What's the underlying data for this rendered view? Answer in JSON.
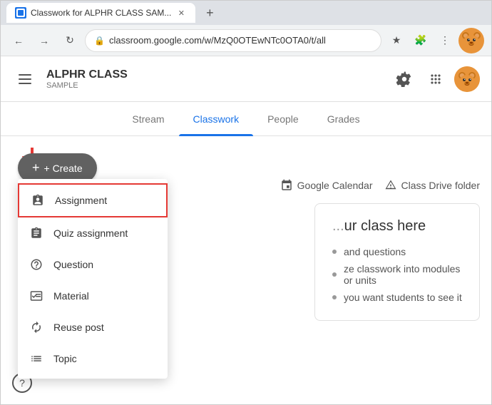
{
  "browser": {
    "tab_title": "Classwork for ALPHR CLASS SAM...",
    "url": "classroom.google.com/w/MzQ0OTEwNTc0OTA0/t/all",
    "new_tab_label": "+"
  },
  "header": {
    "menu_icon": "☰",
    "title": "ALPHR CLASS",
    "subtitle": "SAMPLE",
    "settings_icon": "⚙",
    "apps_icon": "⋮⋮⋮",
    "avatar_emoji": "🐻"
  },
  "nav": {
    "tabs": [
      {
        "label": "Stream",
        "active": false
      },
      {
        "label": "Classwork",
        "active": true
      },
      {
        "label": "People",
        "active": false
      },
      {
        "label": "Grades",
        "active": false
      }
    ]
  },
  "toolbar": {
    "create_label": "+ Create",
    "google_calendar_label": "Google Calendar",
    "class_drive_label": "Class Drive folder"
  },
  "dropdown": {
    "items": [
      {
        "id": "assignment",
        "label": "Assignment",
        "icon": "assignment",
        "highlighted": true
      },
      {
        "id": "quiz-assignment",
        "label": "Quiz assignment",
        "icon": "quiz"
      },
      {
        "id": "question",
        "label": "Question",
        "icon": "question"
      },
      {
        "id": "material",
        "label": "Material",
        "icon": "material"
      },
      {
        "id": "reuse-post",
        "label": "Reuse post",
        "icon": "reuse"
      },
      {
        "id": "topic",
        "label": "Topic",
        "icon": "topic"
      }
    ]
  },
  "content": {
    "title": "ur class here",
    "items": [
      "and questions",
      "ze classwork into modules or units",
      "you want students to see it"
    ]
  },
  "help": {
    "icon": "?"
  }
}
